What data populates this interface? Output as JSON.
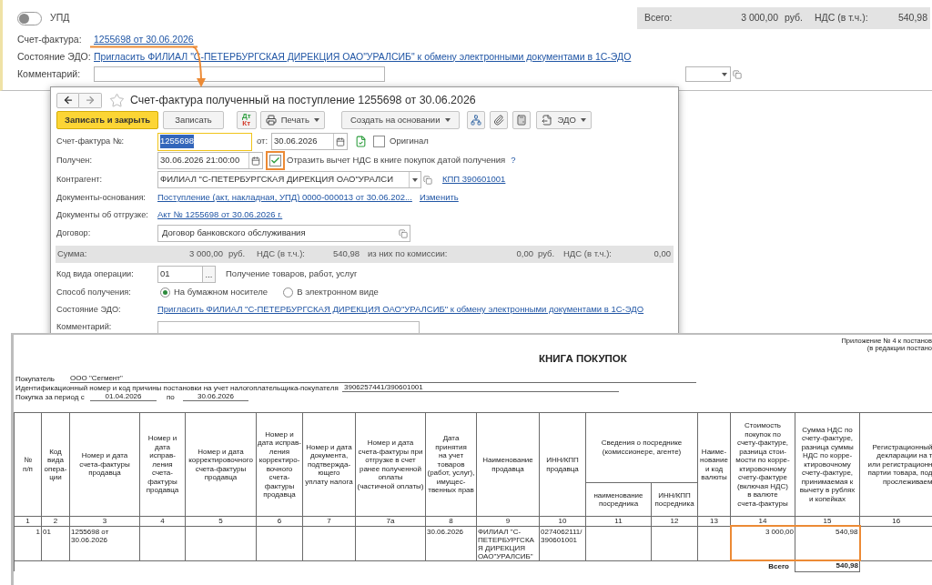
{
  "background_form": {
    "upd_toggle": {
      "label": "УПД",
      "on": false
    },
    "totals": {
      "total_label": "Всего:",
      "total": "3 000,00",
      "currency": "руб.",
      "vat_label": "НДС (в т.ч.):",
      "vat": "540,98"
    },
    "invoice": {
      "label": "Счет-фактура:",
      "link": "1255698 от 30.06.2026",
      "highlighted": true
    },
    "edo": {
      "label": "Состояние ЭДО:",
      "link": "Пригласить ФИЛИАЛ \"С-ПЕТЕРБУРГСКАЯ ДИРЕКЦИЯ ОАО\"УРАЛСИБ\" к обмену электронными документами в 1С-ЭДО"
    },
    "comment": {
      "label": "Комментарий:"
    }
  },
  "dialog": {
    "title": "Счет-фактура полученный на поступление 1255698 от 30.06.2026",
    "favorite": false,
    "toolbar": [
      {
        "kind": "primary",
        "label": "Записать и закрыть"
      },
      {
        "kind": "button",
        "label": "Записать"
      },
      {
        "kind": "dtkt",
        "lines": [
          "Дт",
          "Кт"
        ]
      },
      {
        "kind": "print",
        "label": "Печать"
      },
      {
        "kind": "menu",
        "label": "Создать на основании"
      },
      {
        "kind": "structure"
      },
      {
        "kind": "attach"
      },
      {
        "kind": "list"
      },
      {
        "kind": "edo",
        "label": "ЭДО"
      }
    ],
    "invoice_number": {
      "label": "Счет-фактура №:",
      "value": "1255698",
      "focused": true,
      "date_label": "от:",
      "date": "30.06.2026"
    },
    "original": {
      "label": "Оригинал",
      "checked": false
    },
    "received": {
      "label": "Получен:",
      "value": "30.06.2026 21:00:00"
    },
    "deduction": {
      "label": "Отразить вычет НДС в книге покупок датой получения",
      "checked": true,
      "highlighted": true,
      "help": "?"
    },
    "counterparty": {
      "label": "Контрагент:",
      "value": "ФИЛИАЛ \"С-ПЕТЕРБУРГСКАЯ ДИРЕКЦИЯ ОАО\"УРАЛСИ",
      "kpp_link": "КПП 390601001"
    },
    "base_documents": {
      "label": "Документы-основания:",
      "link": "Поступление (акт, накладная, УПД) 0000-000013 от 30.06.202...",
      "change_link": "Изменить"
    },
    "shipment_documents": {
      "label": "Документы об отгрузке:",
      "link": "Акт № 1255698 от 30.06.2026 г."
    },
    "contract": {
      "label": "Договор:",
      "value": "Договор банковского обслуживания"
    },
    "sum_bar": {
      "label": "Сумма:",
      "amount": "3 000,00",
      "currency": "руб.",
      "vat_label": "НДС (в т.ч.):",
      "vat": "540,98",
      "commission_label": "из них по комиссии:",
      "commission_amount": "0,00",
      "commission_currency": "руб.",
      "commission_vat_label": "НДС (в т.ч.):",
      "commission_vat": "0,00"
    },
    "operation_code": {
      "label": "Код вида операции:",
      "value": "01",
      "select_button": "...",
      "description": "Получение товаров, работ, услуг"
    },
    "receipt_method": {
      "label": "Способ получения:",
      "options": [
        {
          "label": "На бумажном носителе",
          "selected": true
        },
        {
          "label": "В электронном виде",
          "selected": false
        }
      ]
    },
    "edo": {
      "label": "Состояние ЭДО:",
      "link": "Пригласить ФИЛИАЛ \"С-ПЕТЕРБУРГСКАЯ ДИРЕКЦИЯ ОАО\"УРАЛСИБ\" к обмену электронными документами в 1С-ЭДО"
    },
    "comment": {
      "label": "Комментарий:"
    }
  },
  "report": {
    "appendix": [
      "Приложение № 4 к постанов",
      "(в редакции постано"
    ],
    "title": "КНИГА ПОКУПОК",
    "buyer": {
      "label": "Покупатель",
      "value": "ООО \"Сегмент\""
    },
    "taxpayer_id": {
      "label": "Идентификационный номер и код причины постановки на учет налогоплательщика-покупателя",
      "value": "3906257441/390601001"
    },
    "period": {
      "label": "Покупка за период с",
      "from": "01.04.2026",
      "to_label": "по",
      "to": "30.06.2026"
    },
    "table": {
      "columns": [
        {
          "heading": "№\nп/п",
          "number": "1"
        },
        {
          "heading": "Код\nвида\nопера-\nции",
          "number": "2"
        },
        {
          "heading": "Номер и дата\nсчета-фактуры\nпродавца",
          "number": "3"
        },
        {
          "heading": "Номер и\nдата\nисправ-\nления\nсчета-\nфактуры\nпродавца",
          "number": "4"
        },
        {
          "heading": "Номер и дата\nкорректировочного\nсчета-фактуры\nпродавца",
          "number": "5"
        },
        {
          "heading": "Номер и\nдата исправ-\nления\nкорректиро-\nвочного\nсчета-\nфактуры\nпродавца",
          "number": "6"
        },
        {
          "heading": "Номер и дата\nдокумента,\nподтвержда-\nющего\nуплату налога",
          "number": "7"
        },
        {
          "heading": "Номер и дата\nсчета-фактуры при\nотгрузке в счет\nранее полученной\nоплаты\n(частичной оплаты)",
          "number": "7а"
        },
        {
          "heading": "Дата\nпринятия\nна учет\nтоваров\n(работ, услуг),\nимущес-\nтвенных прав",
          "number": "8"
        },
        {
          "heading": "Наименование\nпродавца",
          "number": "9"
        },
        {
          "heading": "ИНН/КПП\nпродавца",
          "number": "10"
        },
        {
          "group": "Сведения о посреднике\n(комиссионере, агенте)",
          "columns": [
            {
              "heading": "наименование\nпосредника",
              "number": "11"
            },
            {
              "heading": "ИНН/КПП\nпосредника",
              "number": "12"
            }
          ]
        },
        {
          "heading": "Наиме-\nнование\nи код\nвалюты",
          "number": "13"
        },
        {
          "heading": "Стоимость\nпокупок по\nсчету-фактуре,\nразница стои-\nмости по корре-\nктировочному\nсчету-фактуре\n(включая НДС)\nв валюте\nсчета-фактуры",
          "number": "14"
        },
        {
          "heading": "Сумма НДС по\nсчету-фактуре,\nразница суммы\nНДС по корре-\nктировочному\nсчету-фактуре,\nпринимаемая к\nвычету в рублях\nи копейках",
          "number": "15"
        },
        {
          "heading": "Регистрационный\nдекларации на т\nили регистрационн\nпартии товара, под\nпрослеживаем",
          "number": "16"
        }
      ],
      "rows": [
        {
          "number": "1",
          "operation_code": "01",
          "seller_invoice": "1255698 от 30.06.2026",
          "acceptance_date": "30.06.2026",
          "seller": "ФИЛИАЛ \"С-ПЕТЕРБУРГСКАЯ ДИРЕКЦИЯ ОАО\"УРАЛСИБ\"",
          "seller_inn_kpp": "0274062111/390601001",
          "cost": "3 000,00",
          "vat": "540,98",
          "highlighted": true
        }
      ],
      "total": {
        "label": "Всего",
        "vat": "540,98"
      }
    }
  }
}
